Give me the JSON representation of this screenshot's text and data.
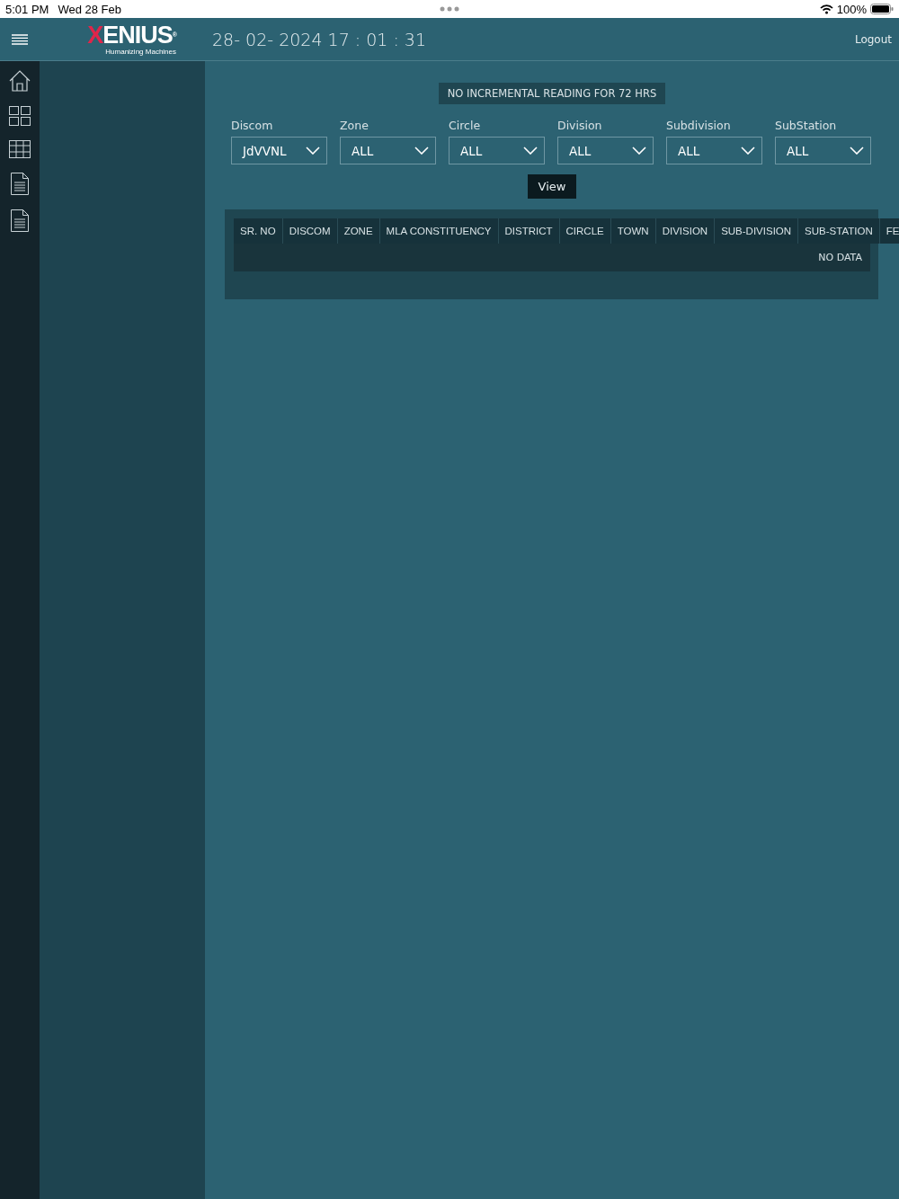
{
  "status_bar": {
    "time": "5:01 PM",
    "date": "Wed 28 Feb",
    "battery": "100%"
  },
  "header": {
    "logo": "XENIUS",
    "logo_mark": "®",
    "tagline": "Humanizing Machines",
    "datetime": "28- 02- 2024 17 : 01 : 31",
    "logout": "Logout"
  },
  "sidebar": {
    "items": [
      {
        "kind": "home"
      },
      {
        "kind": "grid"
      },
      {
        "kind": "table"
      },
      {
        "kind": "document"
      },
      {
        "kind": "document"
      }
    ]
  },
  "notice": "NO INCREMENTAL READING FOR 72 HRS",
  "filters": [
    {
      "label": "Discom",
      "value": "JdVVNL"
    },
    {
      "label": "Zone",
      "value": "ALL"
    },
    {
      "label": "Circle",
      "value": "ALL"
    },
    {
      "label": "Division",
      "value": "ALL"
    },
    {
      "label": "Subdivision",
      "value": "ALL"
    },
    {
      "label": "SubStation",
      "value": "ALL"
    }
  ],
  "view_button": "View",
  "table": {
    "columns": [
      "SR. NO",
      "DISCOM",
      "ZONE",
      "MLA CONSTITUENCY",
      "DISTRICT",
      "CIRCLE",
      "TOWN",
      "DIVISION",
      "SUB-DIVISION",
      "SUB-STATION",
      "FE"
    ],
    "empty_text": "NO DATA"
  }
}
